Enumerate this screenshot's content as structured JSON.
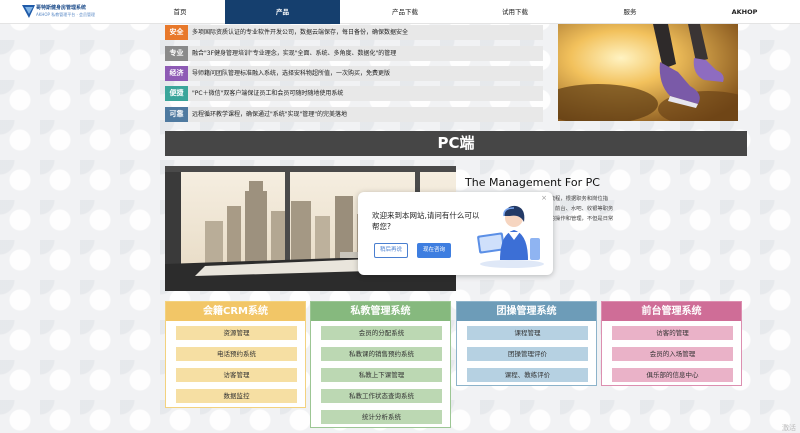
{
  "nav": {
    "logo_title": "哥特斯健身房管理系统",
    "logo_subtitle": "AKHOP 私教管理平台 · 会员管理",
    "items": [
      {
        "label": "首页"
      },
      {
        "label": "产品"
      },
      {
        "label": "产品下载"
      },
      {
        "label": "试用下载"
      },
      {
        "label": "服务"
      },
      {
        "label": "AKHOP"
      }
    ]
  },
  "features": [
    {
      "tag": "安全",
      "color": "#e8792b",
      "text": "多项国际资质认证的专业软件开发公司，数据云端保存，每日备份，确保数据安全"
    },
    {
      "tag": "专业",
      "color": "#8a8a8a",
      "text": "融合\"3F健身管理培训\"专业理念，实现\"全面、系统、多角度、数据化\"的管理"
    },
    {
      "tag": "经济",
      "color": "#8e5bb5",
      "text": "导师籍问团队管理标准融入系统，选择安科物超所值，一次购买，免费更版"
    },
    {
      "tag": "便捷",
      "color": "#3aa59a",
      "text": "\"PC＋微信\"双客户端保证员工和会员可随时随地使用系统"
    },
    {
      "tag": "可靠",
      "color": "#4f7aa0",
      "text": "远程循环教学课程，确保通过\"系统\"实现\"管理\"的完美落地"
    }
  ],
  "pc_banner": {
    "title": "PC端"
  },
  "intro": {
    "title": "The Management For PC",
    "lines": [
      "统）完全依照健身俱乐部的实际运营流程，根据职务和岗位指",
      "理、私人教练、私教经理、团操教练、前台、水吧、收银等职务",
      "使用者针对自己的职务范围进行日常的操作和管理，不但是日常",
      "岗位人员的上岗培训教材。"
    ]
  },
  "chat": {
    "message": "欢迎来到本网站,请问有什么可以帮您?",
    "later_label": "稍后再说",
    "now_label": "现在咨询",
    "close_glyph": "×"
  },
  "systems": [
    {
      "title": "会籍CRM系统",
      "head_color": "#f2c667",
      "item_color": "#f6dfa3",
      "border_color": "#f3d27e",
      "items": [
        "资源管理",
        "电话预约系统",
        "访客管理",
        "数据监控"
      ]
    },
    {
      "title": "私教管理系统",
      "head_color": "#86b97e",
      "item_color": "#bcd8b3",
      "border_color": "#9cc694",
      "items": [
        "会员的分配系统",
        "私教课的销售预约系统",
        "私教上下课管理",
        "私教工作状态查询系统",
        "统计分析系统"
      ]
    },
    {
      "title": "团操管理系统",
      "head_color": "#6d9cb8",
      "item_color": "#b6d1e2",
      "border_color": "#8db3ca",
      "items": [
        "课程管理",
        "团操管理评价",
        "课程、教练评价"
      ]
    },
    {
      "title": "前台管理系统",
      "head_color": "#cf6d97",
      "item_color": "#eab2c8",
      "border_color": "#dc8fb0",
      "items": [
        "访客的管理",
        "会员的入场管理",
        "俱乐部的信息中心"
      ]
    }
  ],
  "watermark": "激活"
}
